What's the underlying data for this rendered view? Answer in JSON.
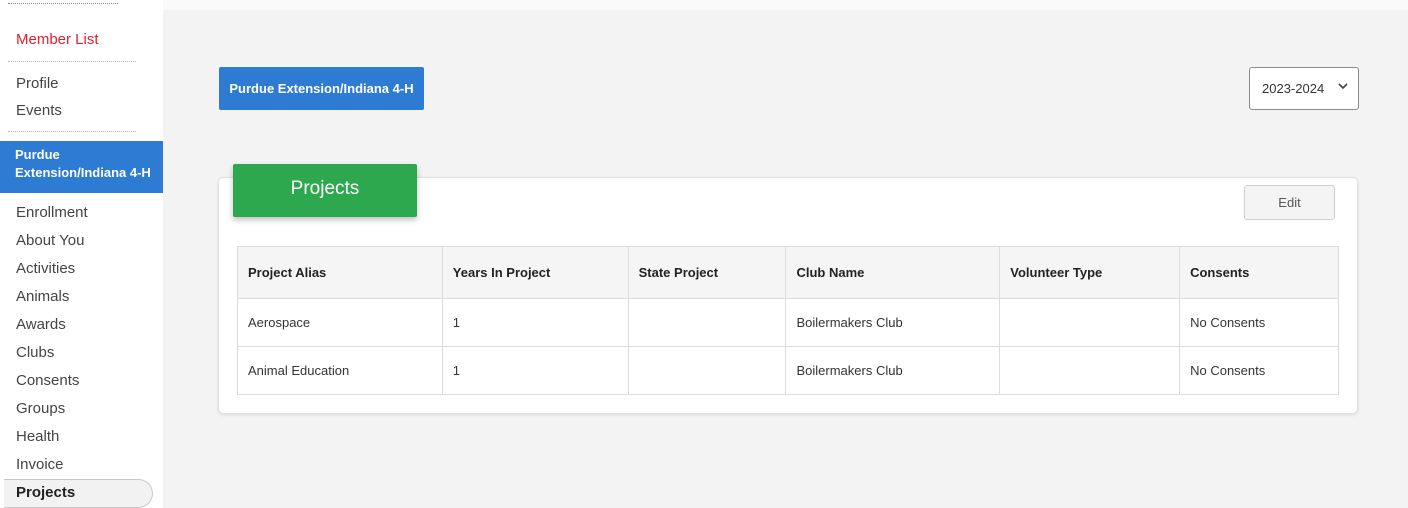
{
  "sidebar": {
    "member_list": "Member List",
    "links_top": [
      "Profile",
      "Events"
    ],
    "active_org": [
      "Purdue",
      "Extension/Indiana 4-H"
    ],
    "items": [
      "Enrollment",
      "About You",
      "Activities",
      "Animals",
      "Awards",
      "Clubs",
      "Consents",
      "Groups",
      "Health",
      "Invoice"
    ],
    "selected": "Projects"
  },
  "header": {
    "org_button": "Purdue Extension/Indiana 4-H",
    "year_select": "2023-2024"
  },
  "card": {
    "title": "Projects",
    "edit_label": "Edit",
    "columns": [
      "Project Alias",
      "Years In Project",
      "State Project",
      "Club Name",
      "Volunteer Type",
      "Consents"
    ],
    "rows": [
      [
        "Aerospace",
        "1",
        "",
        "Boilermakers Club",
        "",
        "No Consents"
      ],
      [
        "Animal Education",
        "1",
        "",
        "Boilermakers Club",
        "",
        "No Consents"
      ]
    ]
  },
  "colors": {
    "primary_blue": "#2d7bd3",
    "projects_green": "#2ea84f",
    "member_list_red": "#e0202e"
  },
  "icons": {
    "select_chevron": "chevron-down-icon"
  }
}
